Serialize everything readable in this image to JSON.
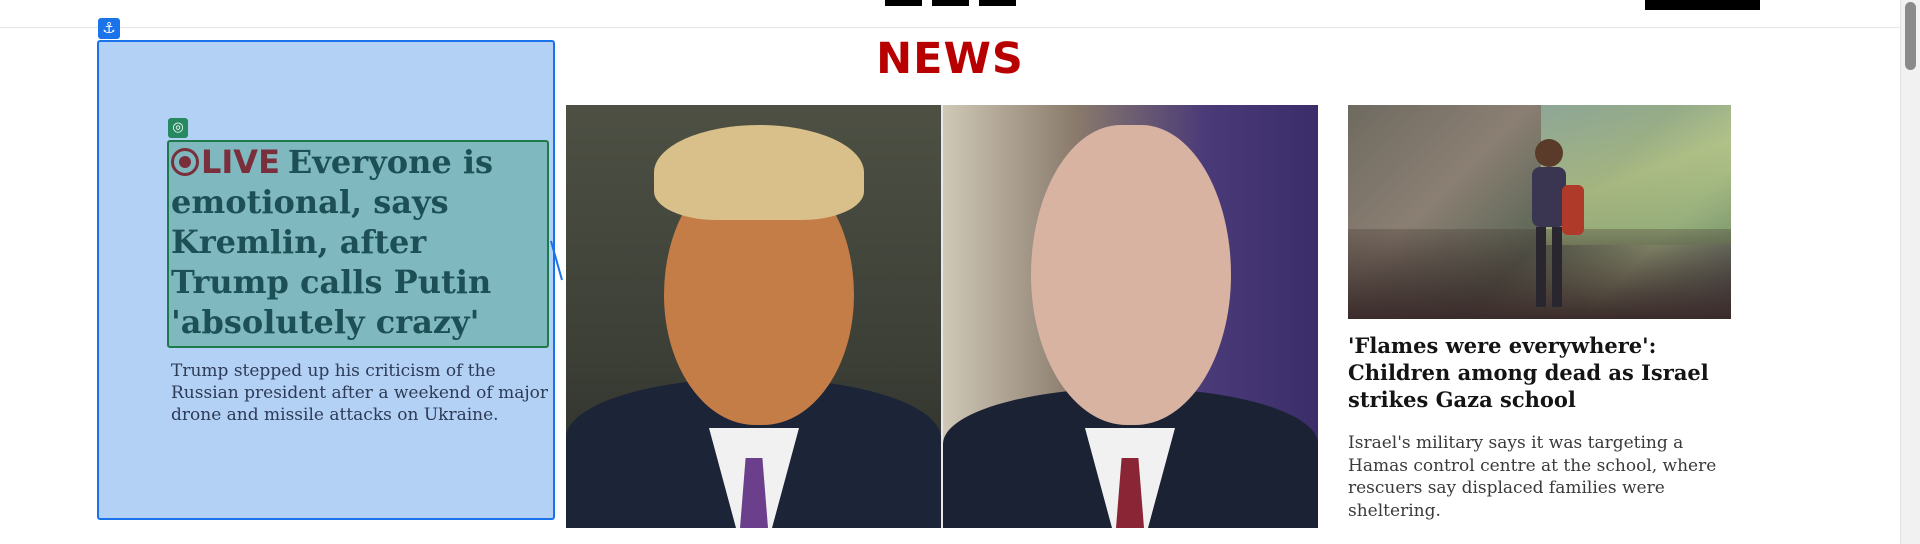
{
  "header": {
    "brand": "NEWS"
  },
  "lead_story": {
    "live_label": "LIVE",
    "headline": "Everyone is emotional, says Kremlin, after Trump calls Putin 'absolutely crazy'",
    "summary": "Trump stepped up his criticism of the Russian president after a weekend of major drone and missile attacks on Ukraine."
  },
  "side_story": {
    "headline": "'Flames were everywhere': Children among dead as Israel strikes Gaza school",
    "summary": "Israel's military says it was targeting a Hamas control centre at the school, where rescuers say displaced families were sheltering."
  },
  "editor_overlay": {
    "anchor_icon": "⚓",
    "target_icon": "◎"
  },
  "colors": {
    "brand_red": "#b80000",
    "overlay_blue": "#1a73e8",
    "overlay_fill": "#b3d0f5",
    "selection_green": "#1e7a4a",
    "live_maroon": "#7a2f3c"
  }
}
